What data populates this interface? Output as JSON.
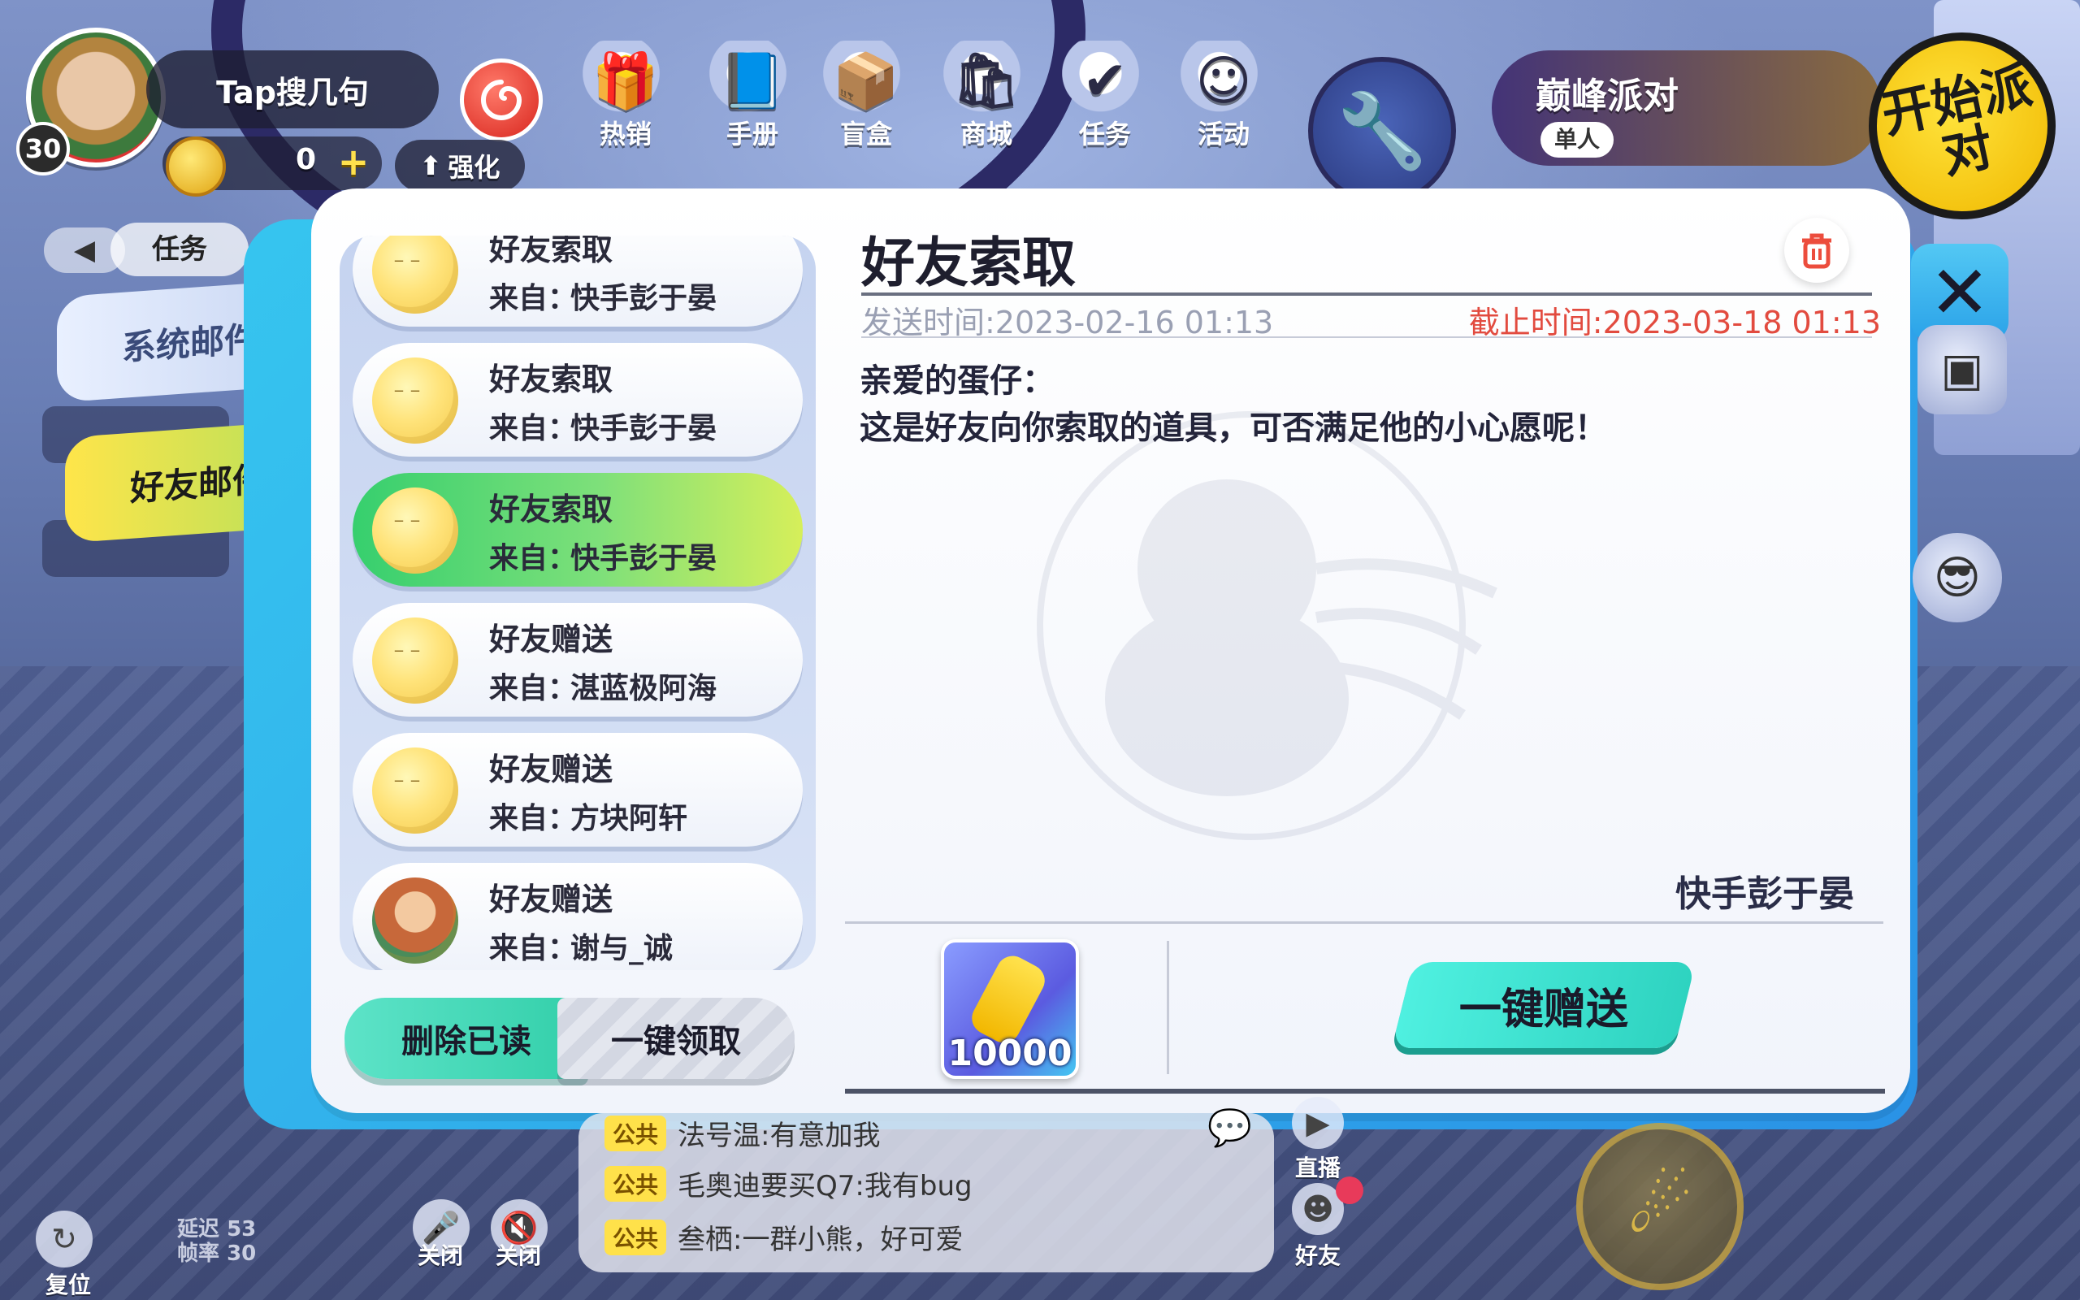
{
  "hud": {
    "player_name": "Tap搜几句",
    "level": "30",
    "coins": "0",
    "boost_label": "强化",
    "menu": [
      {
        "label": "热销",
        "icon": "gift-icon"
      },
      {
        "label": "手册",
        "icon": "handbook-icon"
      },
      {
        "label": "盲盒",
        "icon": "blindbox-icon"
      },
      {
        "label": "商城",
        "icon": "shop-bag-icon"
      },
      {
        "label": "任务",
        "icon": "task-check-icon"
      },
      {
        "label": "活动",
        "icon": "event-icon"
      }
    ],
    "mode_title": "巅峰派对",
    "mode_sub": "单人",
    "start_label": "开始派对"
  },
  "left_panel": {
    "task_label": "任务",
    "tabs": [
      {
        "label": "系统邮件",
        "active": false
      },
      {
        "label": "好友邮件",
        "active": true
      }
    ]
  },
  "mail_list": [
    {
      "title": "好友索取",
      "from_prefix": "来自：",
      "from": "快手彭于晏",
      "active": false,
      "avatar": "yellow"
    },
    {
      "title": "好友索取",
      "from_prefix": "来自：",
      "from": "快手彭于晏",
      "active": false,
      "avatar": "yellow"
    },
    {
      "title": "好友索取",
      "from_prefix": "来自：",
      "from": "快手彭于晏",
      "active": true,
      "avatar": "yellow"
    },
    {
      "title": "好友赠送",
      "from_prefix": "来自：",
      "from": "湛蓝极阿海",
      "active": false,
      "avatar": "yellow"
    },
    {
      "title": "好友赠送",
      "from_prefix": "来自：",
      "from": "方块阿轩",
      "active": false,
      "avatar": "yellow"
    },
    {
      "title": "好友赠送",
      "from_prefix": "来自：",
      "from": "谢与_诚",
      "active": false,
      "avatar": "photo"
    }
  ],
  "list_actions": {
    "delete_read": "删除已读",
    "claim_all": "一键领取"
  },
  "detail": {
    "title": "好友索取",
    "send_time": "发送时间:2023-02-16 01:13",
    "deadline": "截止时间:2023-03-18 01:13",
    "greeting": "亲爱的蛋仔：",
    "body": "这是好友向你索取的道具，可否满足他的小心愿呢！",
    "signature": "快手彭于晏",
    "item_qty": "10000",
    "gift_button": "一键赠送",
    "colors": {
      "deadline": "#e24b3f",
      "gift_button": "#2ed3c0"
    }
  },
  "chat": [
    {
      "tag": "公共",
      "text": "法号温:有意加我"
    },
    {
      "tag": "公共",
      "text": "毛奥迪要买Q7:我有bug"
    },
    {
      "tag": "公共",
      "text": "叁栖:一群小熊，好可爱"
    }
  ],
  "bottom": {
    "reset_label": "复位",
    "latency_label": "延迟",
    "latency_value": "53",
    "fps_label": "帧率",
    "fps_value": "30",
    "mic_label": "关闭",
    "speaker_label": "关闭",
    "live_label": "直播",
    "friends_label": "好友"
  }
}
